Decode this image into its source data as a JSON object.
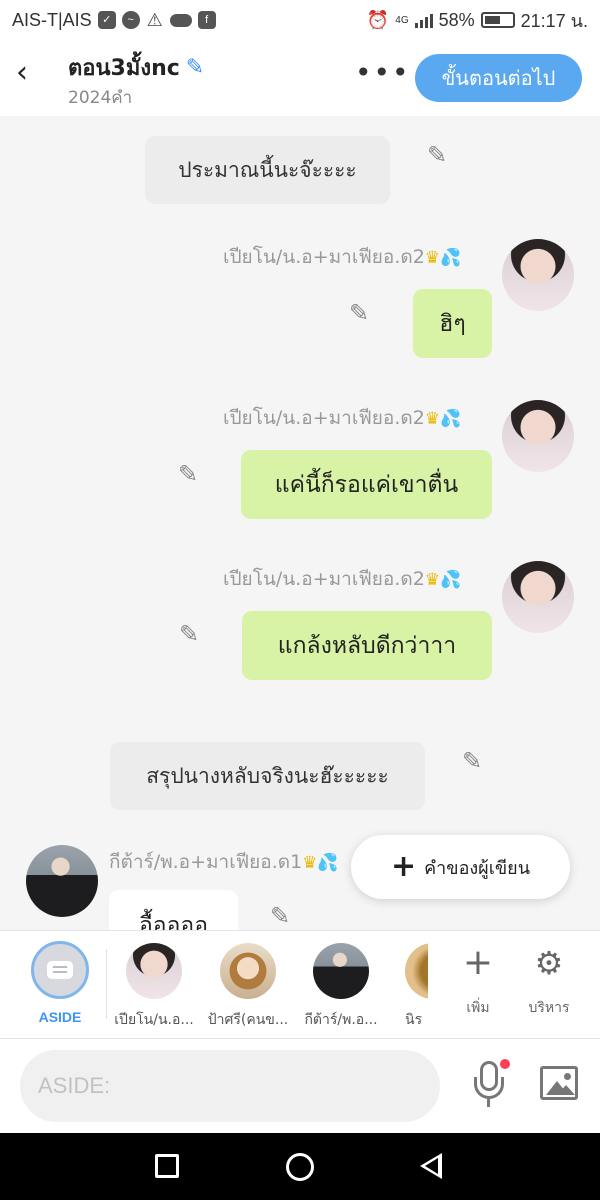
{
  "status_bar": {
    "carrier": "AIS-T|AIS",
    "network": "4G",
    "battery": "58%",
    "time": "21:17 น."
  },
  "header": {
    "title": "ตอน3มั้งnc",
    "word_count": "2024คำ",
    "next_button": "ขั้นตอนต่อไป"
  },
  "messages": {
    "narr1": "ประมาณนี้นะจ๊ะะะะ",
    "m1_name": "เปียโน/น.อ+มาเฟียอ.ด2",
    "m1_text": "ฮิๆ",
    "m2_name": "เปียโน/น.อ+มาเฟียอ.ด2",
    "m2_text": "แค่นี้ก็รอแค่เขาตื่น",
    "m3_name": "เปียโน/น.อ+มาเฟียอ.ด2",
    "m3_text": "แกล้งหลับดีกว่าาา",
    "narr2": "สรุปนางหลับจริงนะฮ๊ะะะะะ",
    "m4_name": "กีต้าร์/พ.อ+มาเฟียอ.ด1",
    "m4_text": "อื้ออออ"
  },
  "fab": {
    "label": "คำของผู้เขียน"
  },
  "character_bar": {
    "aside_label": "ASIDE",
    "characters": [
      {
        "name": "เปียโน/น.อ..."
      },
      {
        "name": "ป้าศรี(คนข..."
      },
      {
        "name": "กีต้าร์/พ.อ..."
      },
      {
        "name": "นิร"
      }
    ],
    "add_label": "เพิ่ม",
    "manage_label": "บริหาร"
  },
  "input": {
    "placeholder": "ASIDE:"
  },
  "colors": {
    "accent": "#5aa9f0",
    "bubble_green": "#d8f3a6",
    "narration_bg": "#ececec"
  },
  "icons": [
    "back-icon",
    "edit-icon",
    "more-icon",
    "crown-icon",
    "droplets-icon",
    "plus-icon",
    "gear-icon",
    "mic-icon",
    "image-icon"
  ]
}
